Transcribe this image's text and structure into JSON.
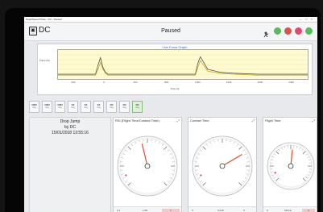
{
  "window": {
    "title": "SmartSpeed Pulse - DC - Paused",
    "controls": [
      "–",
      "□",
      "×"
    ]
  },
  "app": {
    "logo": "DC",
    "status": "Paused"
  },
  "toolbar": {
    "icons": [
      "timing-icon",
      "add-icon",
      "stop-icon",
      "record-icon",
      "settings-icon"
    ]
  },
  "chart": {
    "title": "Live Force Graph",
    "ylabel": "Force (N)",
    "xlabel": "Time (s)",
    "xticks": [
      "-400",
      "0",
      "400",
      "800",
      "1200",
      "1600",
      "2000",
      "2400"
    ]
  },
  "chart_data": {
    "type": "line",
    "title": "Live Force Graph",
    "xlabel": "Time (s)",
    "ylabel": "Force (N)",
    "x": [
      0,
      5,
      10,
      15,
      16,
      17,
      18,
      19,
      20,
      25,
      30,
      40,
      55,
      56,
      57,
      60,
      65,
      70,
      80,
      90,
      100
    ],
    "series": [
      {
        "values": [
          0.5,
          0.5,
          0.5,
          0.5,
          1.4,
          2.2,
          1.2,
          0.7,
          0.5,
          0.5,
          0.5,
          0.5,
          0.5,
          1.6,
          2.3,
          1.0,
          0.7,
          0.6,
          0.5,
          0.5,
          0.5
        ]
      },
      {
        "values": [
          0.4,
          0.4,
          0.4,
          0.4,
          1.0,
          1.7,
          1.0,
          0.6,
          0.4,
          0.4,
          0.4,
          0.4,
          0.4,
          1.2,
          1.9,
          0.8,
          0.6,
          0.5,
          0.4,
          0.4,
          0.4
        ]
      }
    ]
  },
  "tabs": [
    {
      "label": "CMJ",
      "sub": "Avg"
    },
    {
      "label": "CMJ",
      "sub": "Avg"
    },
    {
      "label": "CMJ",
      "sub": "Avg"
    },
    {
      "label": "SJ",
      "sub": "Avg"
    },
    {
      "label": "SJ",
      "sub": "Avg"
    },
    {
      "label": "SJ",
      "sub": "Avg"
    },
    {
      "label": "DJ",
      "sub": "Avg"
    },
    {
      "label": "DJ",
      "sub": "Avg"
    },
    {
      "label": "DJ",
      "sub": "Avg"
    }
  ],
  "active_tab_index": 8,
  "test_info": {
    "name": "Drop Jump",
    "by": "by DC",
    "date": "15/01/2018 13:55:16"
  },
  "gauges": [
    {
      "title": "RSI (Flight Time/Contact Time)",
      "foot": [
        "1.0",
        "1.08",
        "1"
      ],
      "level": 0.45
    },
    {
      "title": "Contact Time",
      "foot": [
        "0",
        "0.215",
        "0"
      ],
      "level": 0.72
    },
    {
      "title": "Flight Time",
      "foot": [
        "0",
        "194ms",
        "0"
      ],
      "level": 0.52
    }
  ],
  "colors": {
    "accent": "#2b67b2",
    "chart_bg": "#fffbd0",
    "active_tab": "#dff0d8",
    "needle": "#e04b2f"
  }
}
